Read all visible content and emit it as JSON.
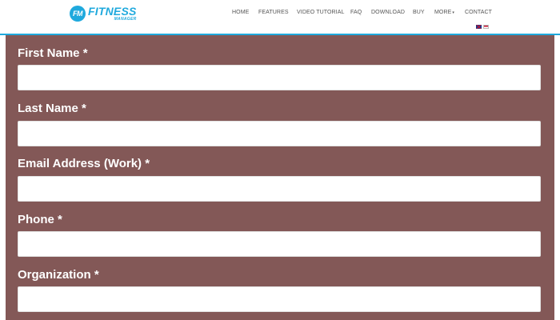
{
  "header": {
    "logo": {
      "badge": "FM",
      "name": "FITNESS",
      "tagline": "MANAGER"
    },
    "nav": [
      {
        "label": "HOME"
      },
      {
        "label": "FEATURES"
      },
      {
        "label": "VIDEO TUTORIAL"
      },
      {
        "label": "FAQ"
      },
      {
        "label": "DOWNLOAD"
      },
      {
        "label": "BUY"
      },
      {
        "label": "MORE"
      },
      {
        "label": "CONTACT"
      }
    ],
    "colors": {
      "accent": "#1fa9dd",
      "nav_text": "#555555"
    }
  },
  "form": {
    "background": "#835857",
    "fields": [
      {
        "label": "First Name *",
        "value": "",
        "placeholder": ""
      },
      {
        "label": "Last Name *",
        "value": "",
        "placeholder": ""
      },
      {
        "label": "Email Address (Work) *",
        "value": "",
        "placeholder": ""
      },
      {
        "label": "Phone *",
        "value": "",
        "placeholder": ""
      },
      {
        "label": "Organization *",
        "value": "",
        "placeholder": ""
      }
    ]
  }
}
